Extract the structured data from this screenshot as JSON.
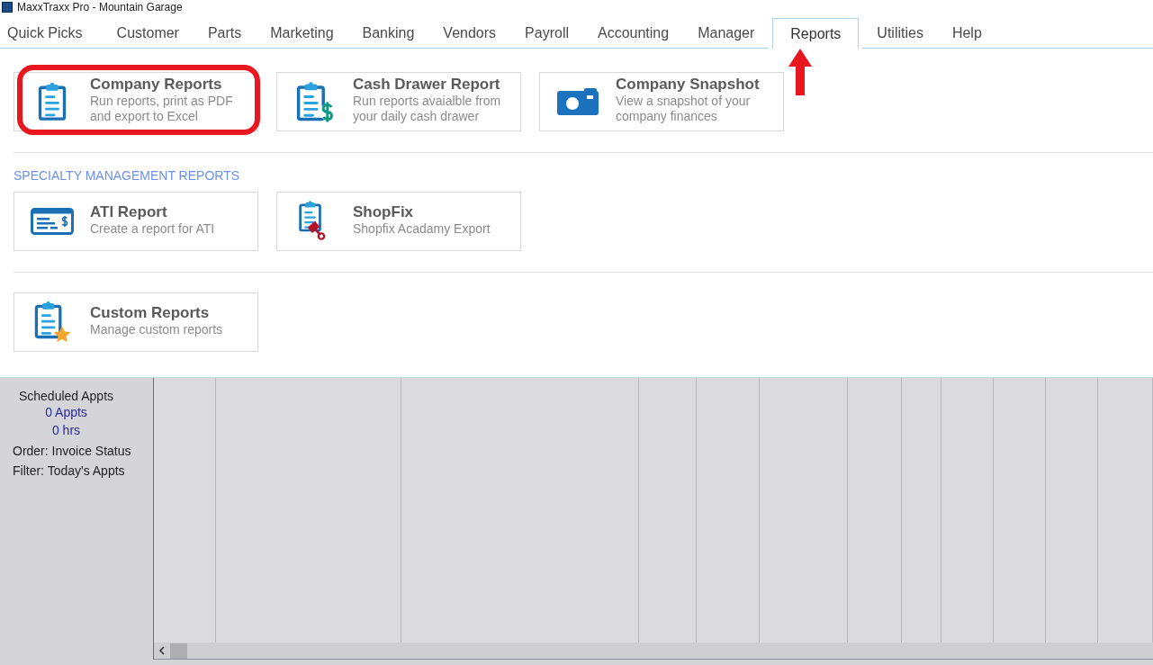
{
  "window": {
    "title": "MaxxTraxx Pro - Mountain Garage"
  },
  "tabs": [
    {
      "label": "Quick Picks",
      "selected": false
    },
    {
      "label": "Customer",
      "selected": false
    },
    {
      "label": "Parts",
      "selected": false
    },
    {
      "label": "Marketing",
      "selected": false
    },
    {
      "label": "Banking",
      "selected": false
    },
    {
      "label": "Vendors",
      "selected": false
    },
    {
      "label": "Payroll",
      "selected": false
    },
    {
      "label": "Accounting",
      "selected": false
    },
    {
      "label": "Manager",
      "selected": false
    },
    {
      "label": "Reports",
      "selected": true
    },
    {
      "label": "Utilities",
      "selected": false
    },
    {
      "label": "Help",
      "selected": false
    }
  ],
  "sections": [
    {
      "cards": [
        {
          "kind": "clipboard",
          "title": "Company Reports",
          "description": "Run reports, print as PDF and export to Excel",
          "highlighted": true
        },
        {
          "kind": "clipboard-dollar",
          "title": "Cash Drawer Report",
          "description": "Run reports avaialble from your daily cash drawer",
          "highlighted": false
        },
        {
          "kind": "camera",
          "title": "Company Snapshot",
          "description": "View a snapshot of your company finances",
          "highlighted": false
        }
      ]
    },
    {
      "heading": "SPECIALTY MANAGEMENT REPORTS",
      "cards": [
        {
          "kind": "check",
          "title": "ATI Report",
          "description": "Create a report for ATI",
          "highlighted": false
        },
        {
          "kind": "clipboard-piston",
          "title": "ShopFix",
          "description": "Shopfix Acadamy Export",
          "highlighted": false
        }
      ]
    },
    {
      "cards": [
        {
          "kind": "clipboard-star",
          "title": "Custom Reports",
          "description": "Manage custom reports",
          "highlighted": false
        }
      ]
    }
  ],
  "schedule": {
    "heading": "Scheduled Appts",
    "appts": "0 Appts",
    "hours": "0 hrs",
    "order": "Order: Invoice Status",
    "filter": "Filter: Today's Appts"
  },
  "annotations": [
    {
      "kind": "arrow"
    }
  ]
}
